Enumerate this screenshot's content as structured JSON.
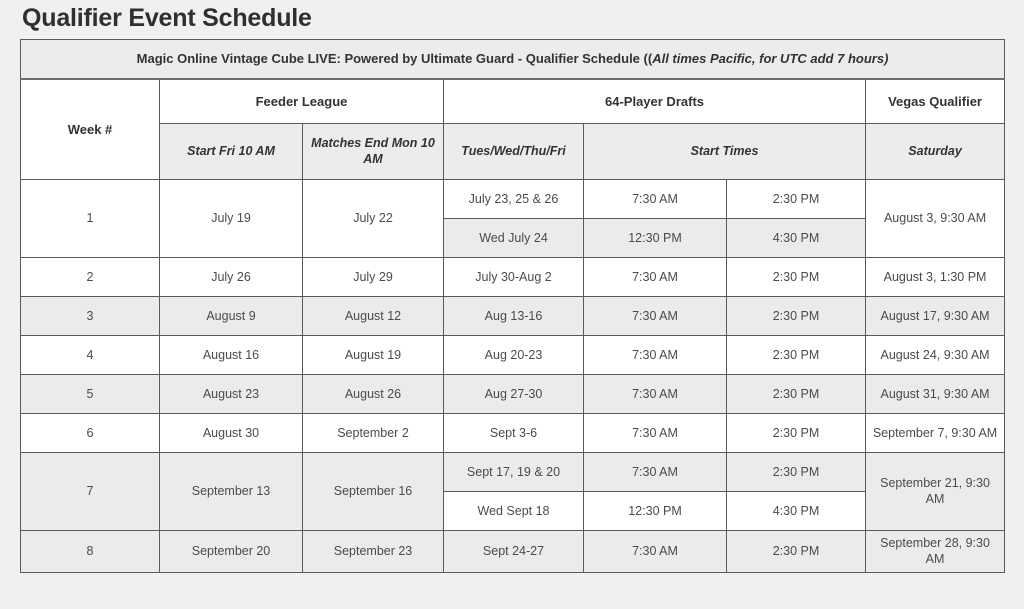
{
  "page": {
    "heading": "Qualifier Event Schedule"
  },
  "table": {
    "caption_plain": "Magic Online Vintage Cube LIVE: Powered by Ultimate Guard - Qualifier Schedule ((",
    "caption_italic": "All times Pacific, for UTC add 7 hours)",
    "headers": {
      "week": "Week #",
      "feeder_league": "Feeder League",
      "drafts": "64-Player Drafts",
      "vegas": "Vegas Qualifier",
      "start_fri": "Start Fri 10 AM",
      "matches_end": "Matches End Mon 10 AM",
      "days": "Tues/Wed/Thu/Fri",
      "start_times": "Start Times",
      "saturday": "Saturday"
    },
    "rows": [
      {
        "week": "1",
        "start_fri": "July 19",
        "matches_end": "July 22",
        "vegas": "August 3, 9:30 AM",
        "vegas_red": true,
        "split": true,
        "sub_rows": [
          {
            "days": "July 23, 25 & 26",
            "time1": "7:30 AM",
            "time2": "2:30 PM",
            "red": true,
            "shade": false
          },
          {
            "days": "Wed July 24",
            "time1": "12:30 PM",
            "time2": "4:30 PM",
            "red": true,
            "shade": true
          }
        ],
        "shade": false
      },
      {
        "week": "2",
        "start_fri": "July 26",
        "matches_end": "July 29",
        "days": "July 30-Aug 2",
        "time1": "7:30 AM",
        "time2": "2:30 PM",
        "vegas": "August 3, 1:30 PM",
        "vegas_red": true,
        "split": false,
        "shade": false
      },
      {
        "week": "3",
        "start_fri": "August 9",
        "matches_end": "August 12",
        "days": "Aug 13-16",
        "time1": "7:30 AM",
        "time2": "2:30 PM",
        "vegas": "August 17, 9:30 AM",
        "vegas_red": false,
        "split": false,
        "shade": true
      },
      {
        "week": "4",
        "start_fri": "August 16",
        "matches_end": "August 19",
        "days": "Aug 20-23",
        "time1": "7:30 AM",
        "time2": "2:30 PM",
        "vegas": "August 24, 9:30 AM",
        "vegas_red": false,
        "split": false,
        "shade": false
      },
      {
        "week": "5",
        "start_fri": "August 23",
        "matches_end": "August 26",
        "days": "Aug 27-30",
        "time1": "7:30 AM",
        "time2": "2:30 PM",
        "vegas": "August 31, 9:30 AM",
        "vegas_red": false,
        "split": false,
        "shade": true
      },
      {
        "week": "6",
        "start_fri": "August 30",
        "matches_end": "September 2",
        "days": "Sept 3-6",
        "time1": "7:30 AM",
        "time2": "2:30 PM",
        "vegas": "September 7, 9:30 AM",
        "vegas_red": false,
        "split": false,
        "shade": false
      },
      {
        "week": "7",
        "start_fri": "September 13",
        "matches_end": "September 16",
        "vegas": "September 21, 9:30 AM",
        "vegas_red": false,
        "split": true,
        "sub_rows": [
          {
            "days": "Sept 17, 19 & 20",
            "time1": "7:30 AM",
            "time2": "2:30 PM",
            "red": true,
            "shade": true
          },
          {
            "days": "Wed Sept 18",
            "time1": "12:30 PM",
            "time2": "4:30 PM",
            "red": true,
            "shade": false
          }
        ],
        "shade": true
      },
      {
        "week": "8",
        "start_fri": "September 20",
        "matches_end": "September 23",
        "days": "Sept 24-27",
        "time1": "7:30 AM",
        "time2": "2:30 PM",
        "vegas": "September 28, 9:30 AM",
        "vegas_red": false,
        "split": false,
        "shade": true
      }
    ]
  },
  "colors": {
    "accent_red": "#bf4235",
    "text": "#4b4b4b",
    "heading": "#2f2f2f",
    "shade": "#ebebeb",
    "page_bg": "#f1f0ee"
  }
}
